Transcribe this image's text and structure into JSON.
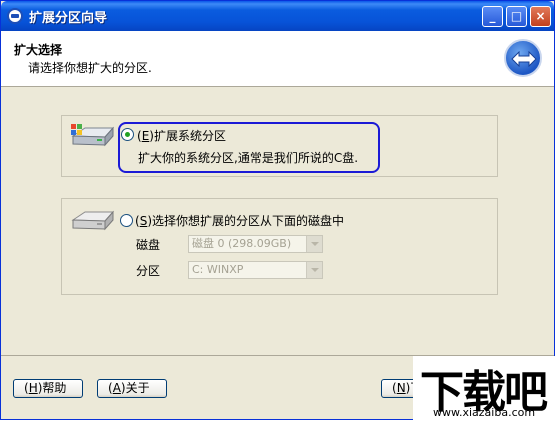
{
  "window": {
    "title": "扩展分区向导"
  },
  "title_buttons": {
    "minimize": "_",
    "maximize": "□",
    "close": "×"
  },
  "header": {
    "title": "扩大选择",
    "subtitle": "请选择你想扩大的分区."
  },
  "option1": {
    "label_prefix": "(",
    "hotkey": "E",
    "label_rest": ")扩展系统分区",
    "description": "扩大你的系统分区,通常是我们所说的C盘.",
    "selected": true
  },
  "option2": {
    "label_prefix": "(",
    "hotkey": "S",
    "label_rest": ")选择你想扩展的分区从下面的磁盘中",
    "selected": false,
    "disk_label": "磁盘",
    "disk_value": "磁盘 0 (298.09GB)",
    "partition_label": "分区",
    "partition_value": "C: WINXP"
  },
  "footer": {
    "help_button": {
      "prefix": "(",
      "hotkey": "H",
      "rest": ")帮助"
    },
    "about_button": {
      "prefix": "(",
      "hotkey": "A",
      "rest": ")关于"
    },
    "next_button": {
      "prefix": "(",
      "hotkey": "N",
      "rest": ")下"
    }
  },
  "watermark": {
    "main": "下载吧",
    "site": "www.xiazaiba.com"
  },
  "colors": {
    "title_bar": "#0a5cdf",
    "focus_ring": "#1b1ad6",
    "radio_dot": "#21a121"
  }
}
